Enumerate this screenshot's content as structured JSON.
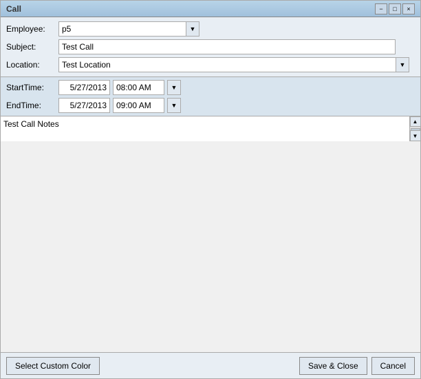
{
  "window": {
    "title": "Call",
    "title_extra": ""
  },
  "title_bar": {
    "controls": {
      "minimize": "−",
      "maximize": "□",
      "close": "×"
    }
  },
  "form": {
    "employee_label": "Employee:",
    "employee_value": "p5",
    "subject_label": "Subject:",
    "subject_value": "Test Call",
    "location_label": "Location:",
    "location_value": "Test Location"
  },
  "time": {
    "start_label": "StartTime:",
    "start_date": "5/27/2013",
    "start_time": "08:00 AM",
    "end_label": "EndTime:",
    "end_date": "5/27/2013",
    "end_time": "09:00 AM"
  },
  "notes": {
    "value": "Test Call Notes"
  },
  "bottom": {
    "custom_color_label": "Select Custom Color",
    "save_close_label": "Save & Close",
    "cancel_label": "Cancel"
  }
}
